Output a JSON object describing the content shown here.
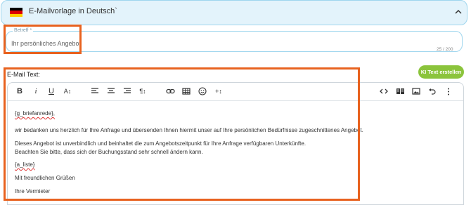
{
  "accordion": {
    "title": "E-Mailvorlage in Deutsch`"
  },
  "subject": {
    "label": "Betreff *",
    "value": "Ihr persönliches Angebot",
    "counter": "25 / 200"
  },
  "ki_button": {
    "label": "KI Text erstellen"
  },
  "email": {
    "label": "E-Mail Text:",
    "lines": [
      "{g_briefanrede},",
      "wir bedanken uns herzlich für Ihre Anfrage und übersenden Ihnen hiermit unser auf Ihre persönlichen Bedürfnisse zugeschnittenes Angebot.",
      "Dieses Angebot ist unverbindlich und beinhaltet die zum Angebotszeitpunkt für Ihre Anfrage verfügbaren Unterkünfte.",
      "Beachten Sie bitte, dass sich der Buchungsstand sehr schnell ändern kann.",
      "{a_liste}",
      "Mit freundlichen Grüßen",
      "Ihre Vermieter"
    ]
  },
  "toolbar": {
    "bold": "B",
    "italic": "i",
    "underline": "U",
    "font_size": "A↕",
    "paragraph": "¶↕",
    "special_char": "+↕"
  },
  "colors": {
    "accent_highlight": "#e8621f",
    "ki_button": "#8bc43c",
    "header_bg": "#e3f3fb",
    "border": "#9fd6ee"
  }
}
